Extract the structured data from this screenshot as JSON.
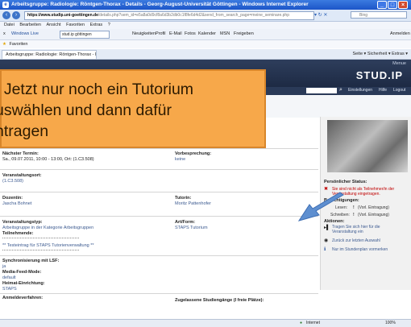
{
  "window": {
    "title": "Arbeitsgruppe: Radiologie: Röntgen-Thorax - Details - Georg-August-Universität Göttingen - Windows Internet Explorer",
    "btn_min": "_",
    "btn_max": "□",
    "btn_close": "×"
  },
  "address": {
    "host": "https://www.studip.uni-goettingen.de",
    "rest": "/details.php?sem_id=e5a8a0d9cf8a6d3b2db0c1f8fe6d4d2&send_from_search_page=meine_seminare.php",
    "search_placeholder": "Bing",
    "back_icon": "‹",
    "forward_icon": "›"
  },
  "menubar": {
    "items": [
      "Datei",
      "Bearbeiten",
      "Ansicht",
      "Favoriten",
      "Extras",
      "?"
    ]
  },
  "toolbar": {
    "close_x": "x",
    "windows_live": "Windows Live",
    "search_value": "stud.ip göttingen",
    "links": [
      "Neuigkeiten",
      "Profil",
      "E-Mail",
      "Fotos",
      "Kalender",
      "MSN",
      "Freigeben"
    ],
    "signin": "Anmelden"
  },
  "favbar": {
    "label": "Favoriten"
  },
  "tab": {
    "label": "Arbeitsgruppe: Radiologie: Röntgen-Thorax - Details -...",
    "tools": "Seite ▾  Sicherheit ▾  Extras ▾"
  },
  "studip": {
    "menue": "Menue",
    "logo": "STUD.IP",
    "nav_items": [
      "Einstellungen",
      "Hilfe",
      "Logout"
    ]
  },
  "callout": {
    "line1": ". Jetzt nur noch ein Tutorium",
    "line2": "uswählen und dann dafür",
    "line3": "ntragen"
  },
  "main": {
    "next_date_label": "Nächster Termin:",
    "next_date_value": "Sa., 09.07.2011, 10:00 - 13:00, Ort: (1.C3.508)",
    "prelim_label": "Vorbesprechung:",
    "prelim_value": "keine",
    "location_label": "Veranstaltungsort:",
    "location_value": "(1.C3.508)",
    "lecturer_label": "Dozentin:",
    "lecturer_value": "Jascha Bohnet",
    "tutors_label": "Tutorin:",
    "tutors_value": "Moritz Pattenhofer",
    "type_label": "Veranstaltungstyp:",
    "type_value": "Arbeitsgruppe in der Kategorie Arbeitsgruppen",
    "participants_label": "Teilnehmende:",
    "form_label": "Art/Form:",
    "form_value": "STAPS Tutorium",
    "description_value": "** Testeintrag für STAPS Tutorienverwaltung **",
    "sync_label": "Synchronisierung mit LSF:",
    "sync_value": "ja",
    "media_label": "Media-Feed-Mode:",
    "media_value": "default",
    "home_label": "Heimat-Einrichtung:",
    "home_value": "STAPS",
    "registration_label": "Anmeldeverfahren:",
    "quota_label": "Zugelassene Studiengänge (I freie Plätze):"
  },
  "panel": {
    "status_label": "Persönlicher Status:",
    "status_text1": "Sie sind nicht als Teilnehmer/in der",
    "status_text2": "Veranstaltung eingetragen.",
    "rights_label": "Berechtigungen:",
    "read": "Lesen:",
    "read_val": "(Vorl. Eintragung)",
    "write": "Schreiben:",
    "write_val": "(Vorl. Eintragung)",
    "actions_label": "Aktionen:",
    "action1a": "Tragen Sie sich hier für die",
    "action1b": "Veranstaltung ein",
    "action2": "Zurück zur letzten Auswahl",
    "action3": "Nur im Stundenplan vormerken"
  },
  "statusbar": {
    "zone": "Internet",
    "zoom": "100%"
  },
  "colors": {
    "callout": "#f7a84a",
    "header": "#1d2a44",
    "accent_red": "#c00000"
  }
}
